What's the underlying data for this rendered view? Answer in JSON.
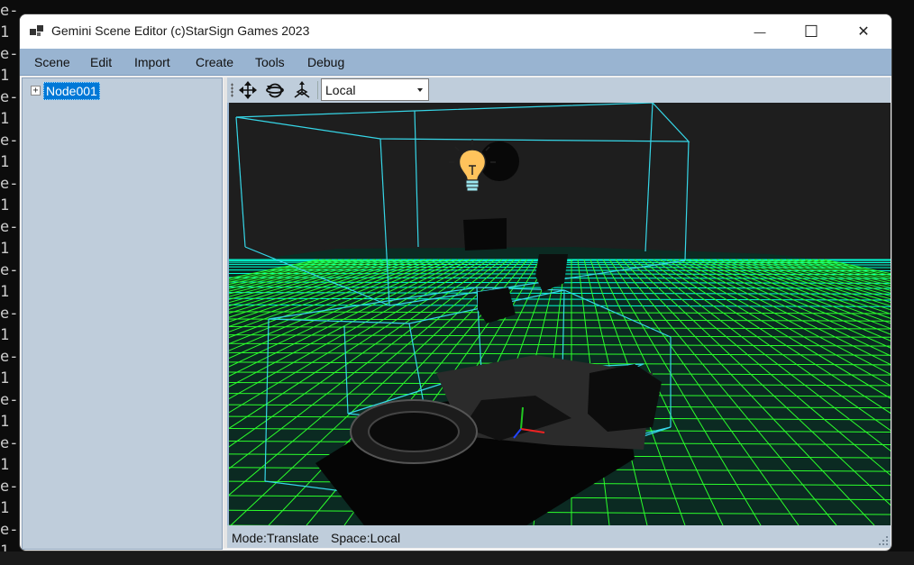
{
  "terminal": {
    "lines": [
      "e-",
      "1",
      "e-",
      "1",
      "e-",
      "1",
      "e-",
      "1",
      "e-",
      "1",
      "e-",
      "1",
      "e-",
      "1",
      "e-",
      "1",
      "e-",
      "1",
      "e-",
      "1",
      "e-",
      "1",
      "e-",
      "1",
      "e-",
      "1"
    ]
  },
  "window": {
    "title": "Gemini Scene Editor (c)StarSign Games 2023",
    "controls": {
      "minimize": "—",
      "maximize": "☐",
      "close": "✕"
    }
  },
  "menu": {
    "items": [
      "Scene",
      "Edit",
      "Import",
      "Create",
      "Tools",
      "Debug"
    ]
  },
  "scene_tree": {
    "expander": "+",
    "root_node": "Node001"
  },
  "toolbar": {
    "tools": [
      "translate-icon",
      "rotate-icon",
      "scale-icon"
    ],
    "space_value": "Local"
  },
  "status": {
    "mode": "Mode:Translate",
    "space": "Space:Local"
  },
  "colors": {
    "menu_bg": "#99b4d1",
    "panel_bg": "#bfcddb",
    "selection": "#0078d7",
    "viewport_bg": "#1e1e1e",
    "grid_near": "#2bff2b",
    "grid_far": "#00ffd5",
    "wireframe": "#36d6e7"
  }
}
